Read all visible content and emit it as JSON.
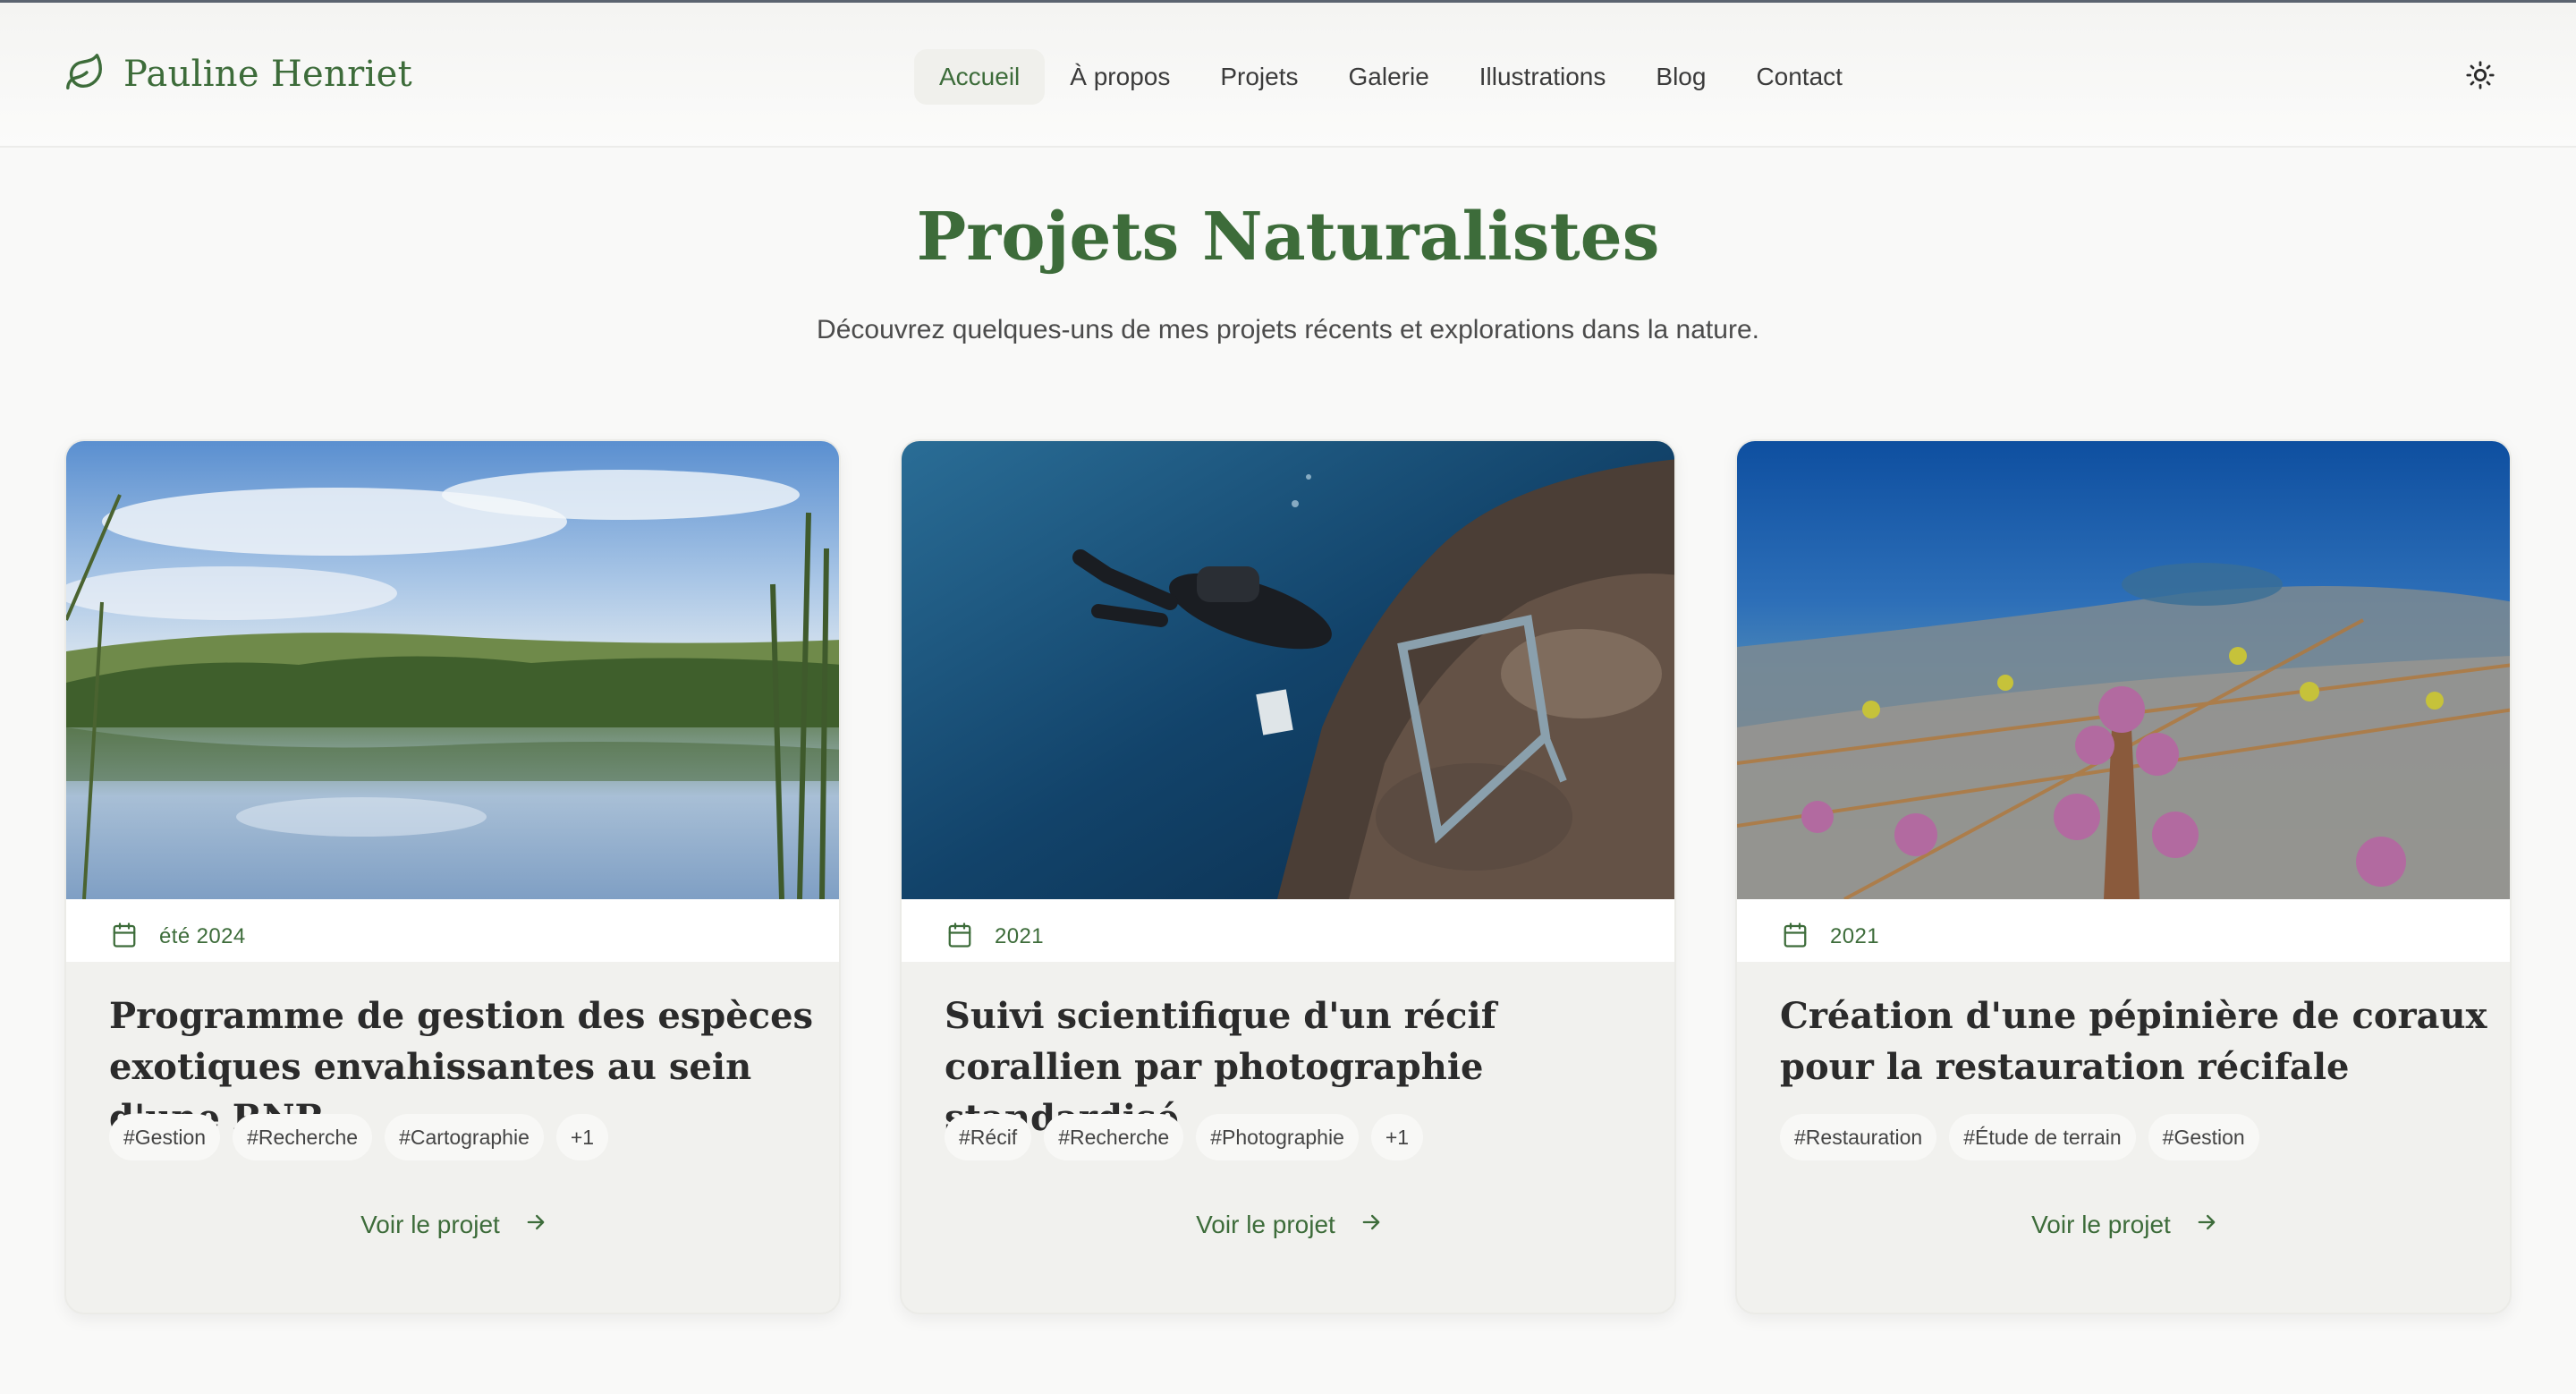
{
  "brand": {
    "name": "Pauline Henriet",
    "icon": "leaf-icon"
  },
  "nav": {
    "items": [
      {
        "label": "Accueil",
        "active": true
      },
      {
        "label": "À propos"
      },
      {
        "label": "Projets"
      },
      {
        "label": "Galerie"
      },
      {
        "label": "Illustrations"
      },
      {
        "label": "Blog"
      },
      {
        "label": "Contact"
      }
    ],
    "theme_toggle_icon": "sun-icon"
  },
  "hero": {
    "title": "Projets Naturalistes",
    "subtitle": "Découvrez quelques-uns de mes projets récents et explorations dans la nature."
  },
  "cards": [
    {
      "date": "été 2024",
      "title": "Programme de gestion des espèces exotiques envahissantes au sein d'une RNR",
      "tags": [
        "#Gestion",
        "#Recherche",
        "#Cartographie",
        "+1"
      ],
      "cta": "Voir le projet",
      "image": "wetland-pond-photo"
    },
    {
      "date": "2021",
      "title": "Suivi scientifique d'un récif corallien par photographie standardisé",
      "tags": [
        "#Récif",
        "#Recherche",
        "#Photographie",
        "+1"
      ],
      "cta": "Voir le projet",
      "image": "diver-coral-reef-photo"
    },
    {
      "date": "2021",
      "title": "Création d'une pépinière de coraux pour la restauration récifale",
      "tags": [
        "#Restauration",
        "#Étude de terrain",
        "#Gestion"
      ],
      "cta": "Voir le projet",
      "image": "coral-nursery-photo"
    }
  ],
  "colors": {
    "accent": "#3d6c3a",
    "background": "#f9f9f8",
    "card": "#f1f1ee"
  }
}
